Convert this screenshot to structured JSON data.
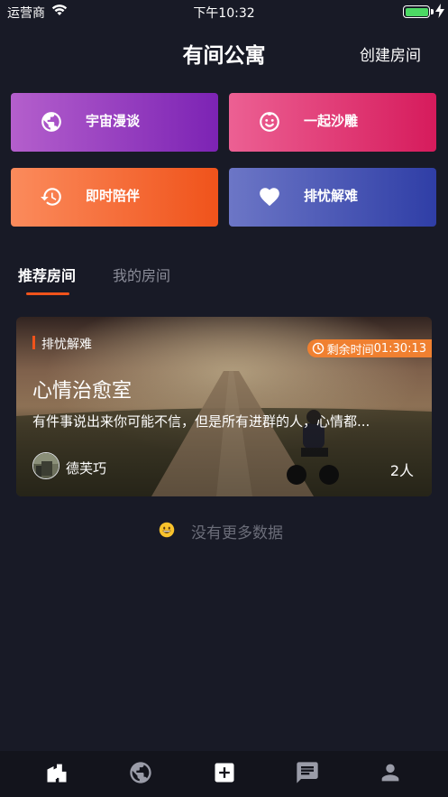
{
  "status_bar": {
    "carrier": "运营商",
    "time": "下午10:32",
    "battery_level": 1.0
  },
  "header": {
    "title": "有间公寓",
    "create_room_label": "创建房间"
  },
  "categories": [
    {
      "label": "宇宙漫谈",
      "icon": "globe-icon",
      "color_start": "#b45fcc",
      "color_end": "#7c23b4"
    },
    {
      "label": "一起沙雕",
      "icon": "baby-face-icon",
      "color_start": "#ec6093",
      "color_end": "#d61b5c"
    },
    {
      "label": "即时陪伴",
      "icon": "history-clock-icon",
      "color_start": "#fb8b5c",
      "color_end": "#f0531b"
    },
    {
      "label": "排忧解难",
      "icon": "heart-icon",
      "color_start": "#6c76c6",
      "color_end": "#2f3ea6"
    }
  ],
  "tabs": [
    {
      "label": "推荐房间",
      "active": true
    },
    {
      "label": "我的房间",
      "active": false
    }
  ],
  "rooms": [
    {
      "tag": "排忧解难",
      "timer_prefix": "剩余时间 ",
      "timer_value": "01:30:13",
      "name": "心情治愈室",
      "description": "有件事说出来你可能不信，但是所有进群的人，心情都...",
      "owner_name": "德芙巧",
      "member_count": "2人"
    }
  ],
  "empty_state": {
    "text": "没有更多数据",
    "icon": "grinning-face-icon"
  },
  "bottom_nav": [
    {
      "icon": "building-icon",
      "active": true
    },
    {
      "icon": "globe-icon",
      "active": false
    },
    {
      "icon": "add-box-icon",
      "active": false
    },
    {
      "icon": "chat-icon",
      "active": false
    },
    {
      "icon": "person-icon",
      "active": false
    }
  ],
  "colors": {
    "background": "#181a26",
    "accent": "#f0531b",
    "muted_text": "#8b8d99",
    "timer_badge": "#f08030"
  }
}
